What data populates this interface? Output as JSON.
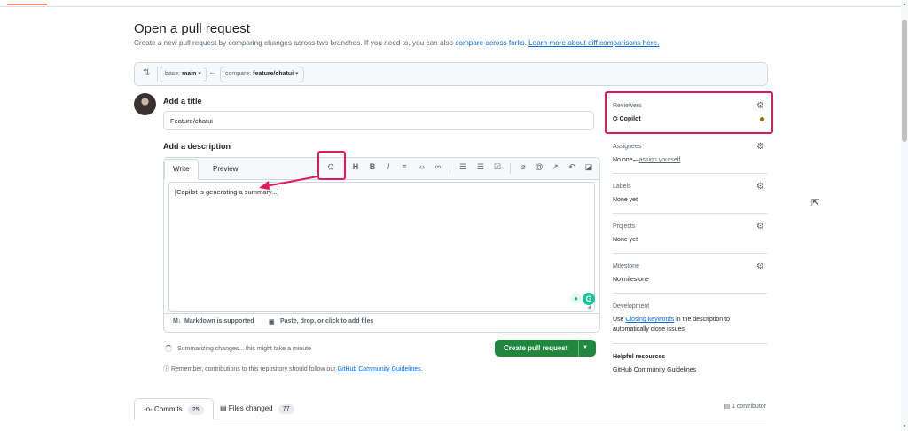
{
  "page": {
    "title": "Open a pull request",
    "subtitle_prefix": "Create a new pull request by comparing changes across two branches. If you need to, you can also",
    "compare_forks_link": "compare across forks.",
    "learn_more_link": "Learn more about diff comparisons here."
  },
  "range": {
    "base_label": "base:",
    "base_value": "main",
    "compare_label": "compare:",
    "compare_value": "feature/chatui"
  },
  "form": {
    "title_heading": "Add a title",
    "title_value": "Feature/chatui",
    "description_heading": "Add a description",
    "tab_write": "Write",
    "tab_preview": "Preview",
    "description_value": "[Copilot is generating a summary...]",
    "markdown_note": "Markdown is supported",
    "attach_note": "Paste, drop, or click to add files",
    "status_text": "Summarizing changes... this might take a minute",
    "create_button": "Create pull request",
    "remember_prefix": "Remember, contributions to this repository should follow our",
    "guidelines_link": "GitHub Community Guidelines",
    "remember_suffix": "."
  },
  "sidebar": {
    "reviewers_heading": "Reviewers",
    "reviewer_name": "Copilot",
    "assignees_heading": "Assignees",
    "assignees_prefix": "No one—",
    "assign_yourself": "assign yourself",
    "labels_heading": "Labels",
    "labels_value": "None yet",
    "projects_heading": "Projects",
    "projects_value": "None yet",
    "milestone_heading": "Milestone",
    "milestone_value": "No milestone",
    "development_heading": "Development",
    "development_prefix": "Use",
    "closing_keywords": "Closing keywords",
    "development_suffix": "in the description to",
    "development_line2": "automatically close issues",
    "helpful_heading": "Helpful resources",
    "helpful_link": "GitHub Community Guidelines"
  },
  "bottom_tabs": {
    "commits_label": "Commits",
    "commits_count": "25",
    "files_label": "Files changed",
    "files_count": "77",
    "contributors": "1 contributor"
  },
  "colors": {
    "accent": "#1f883d",
    "highlight": "#e0195a",
    "link": "#0969da"
  }
}
